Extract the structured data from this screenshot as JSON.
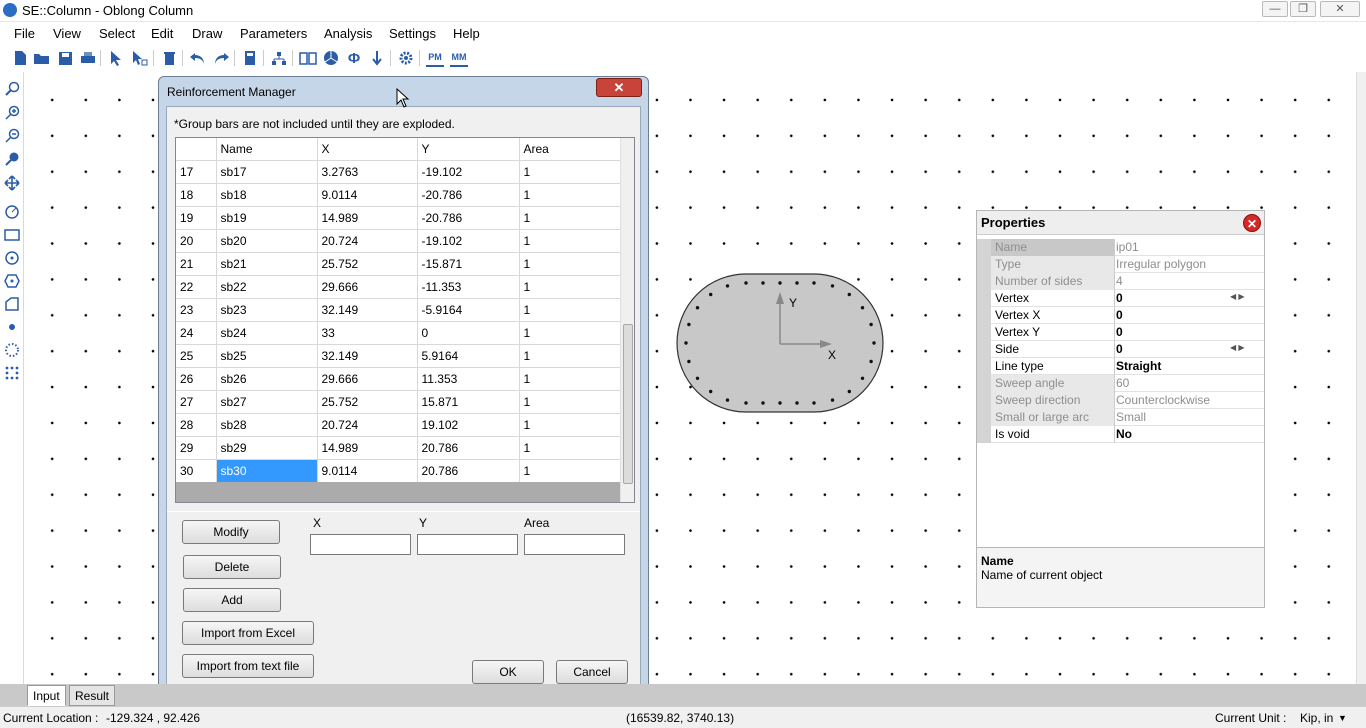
{
  "window": {
    "title": "SE::Column - Oblong Column",
    "minimize": "—",
    "restore": "❐",
    "close": "✕"
  },
  "menu": [
    "File",
    "View",
    "Select",
    "Edit",
    "Draw",
    "Parameters",
    "Analysis",
    "Settings",
    "Help"
  ],
  "toolbar": {
    "icons": [
      "new-file-icon",
      "open-folder-icon",
      "save-icon",
      "print-icon",
      "select-arrow-icon",
      "select-area-icon",
      "delete-icon",
      "undo-icon",
      "redo-icon",
      "calculator-icon",
      "hierarchy-icon",
      "book-icon",
      "pie-icon",
      "phi-icon",
      "arrow-down-icon",
      "settings-gear-icon",
      "pm-icon",
      "mm-icon"
    ],
    "pm_label": "PM",
    "mm_label": "MM",
    "phi": "Φ"
  },
  "leftbar": {
    "icons": [
      "zoom-icon",
      "zoom-in-icon",
      "zoom-out-icon",
      "zoom-window-icon",
      "pan-icon",
      "circle-section-icon",
      "rectangle-icon",
      "ellipse-icon",
      "hexagon-icon",
      "polygon-icon",
      "dot-icon",
      "circle-bars-icon",
      "grid-bars-icon"
    ]
  },
  "dialog": {
    "title": "Reinforcement Manager",
    "close": "✕",
    "note": "*Group bars are not included until they are exploded.",
    "columns": [
      "",
      "Name",
      "X",
      "Y",
      "Area"
    ],
    "rows": [
      [
        "17",
        "sb17",
        "3.2763",
        "-19.102",
        "1"
      ],
      [
        "18",
        "sb18",
        "9.0114",
        "-20.786",
        "1"
      ],
      [
        "19",
        "sb19",
        "14.989",
        "-20.786",
        "1"
      ],
      [
        "20",
        "sb20",
        "20.724",
        "-19.102",
        "1"
      ],
      [
        "21",
        "sb21",
        "25.752",
        "-15.871",
        "1"
      ],
      [
        "22",
        "sb22",
        "29.666",
        "-11.353",
        "1"
      ],
      [
        "23",
        "sb23",
        "32.149",
        "-5.9164",
        "1"
      ],
      [
        "24",
        "sb24",
        "33",
        "0",
        "1"
      ],
      [
        "25",
        "sb25",
        "32.149",
        "5.9164",
        "1"
      ],
      [
        "26",
        "sb26",
        "29.666",
        "11.353",
        "1"
      ],
      [
        "27",
        "sb27",
        "25.752",
        "15.871",
        "1"
      ],
      [
        "28",
        "sb28",
        "20.724",
        "19.102",
        "1"
      ],
      [
        "29",
        "sb29",
        "14.989",
        "20.786",
        "1"
      ],
      [
        "30",
        "sb30",
        "9.0114",
        "20.786",
        "1"
      ]
    ],
    "selected_row": "30",
    "buttons": {
      "modify": "Modify",
      "delete": "Delete",
      "add": "Add",
      "import_excel": "Import from Excel",
      "import_text": "Import from text file",
      "ok": "OK",
      "cancel": "Cancel"
    },
    "fields": {
      "x_label": "X",
      "x_value": "",
      "y_label": "Y",
      "y_value": "",
      "area_label": "Area",
      "area_value": ""
    }
  },
  "section": {
    "axis_y": "Y",
    "axis_x": "X",
    "fill": "#c8c8c8"
  },
  "properties": {
    "title": "Properties",
    "close": "✕",
    "rows": [
      {
        "label": "Name",
        "value": "ip01",
        "readonly": true,
        "selected": true
      },
      {
        "label": "Type",
        "value": "Irregular polygon",
        "readonly": true
      },
      {
        "label": "Number of sides",
        "value": "4",
        "readonly": true
      },
      {
        "label": "Vertex",
        "value": "0",
        "bold": true,
        "spin": true
      },
      {
        "label": "Vertex X",
        "value": "0",
        "bold": true
      },
      {
        "label": "Vertex Y",
        "value": "0",
        "bold": true
      },
      {
        "label": "Side",
        "value": "0",
        "bold": true,
        "spin": true
      },
      {
        "label": "Line type",
        "value": "Straight",
        "bold": true
      },
      {
        "label": "Sweep angle",
        "value": "60",
        "readonly": true
      },
      {
        "label": "Sweep direction",
        "value": "Counterclockwise",
        "readonly": true
      },
      {
        "label": "Small or large arc",
        "value": "Small",
        "readonly": true
      },
      {
        "label": "Is void",
        "value": "No",
        "bold": true
      }
    ],
    "desc_name": "Name",
    "desc_text": "Name of current object"
  },
  "tabs": {
    "input": "Input",
    "result": "Result"
  },
  "status": {
    "location_label": "Current Location :",
    "location_value": "-129.324 , 92.426",
    "pixel": "(16539.82, 3740.13)",
    "unit_label": "Current Unit :",
    "unit_value": "Kip, in"
  }
}
